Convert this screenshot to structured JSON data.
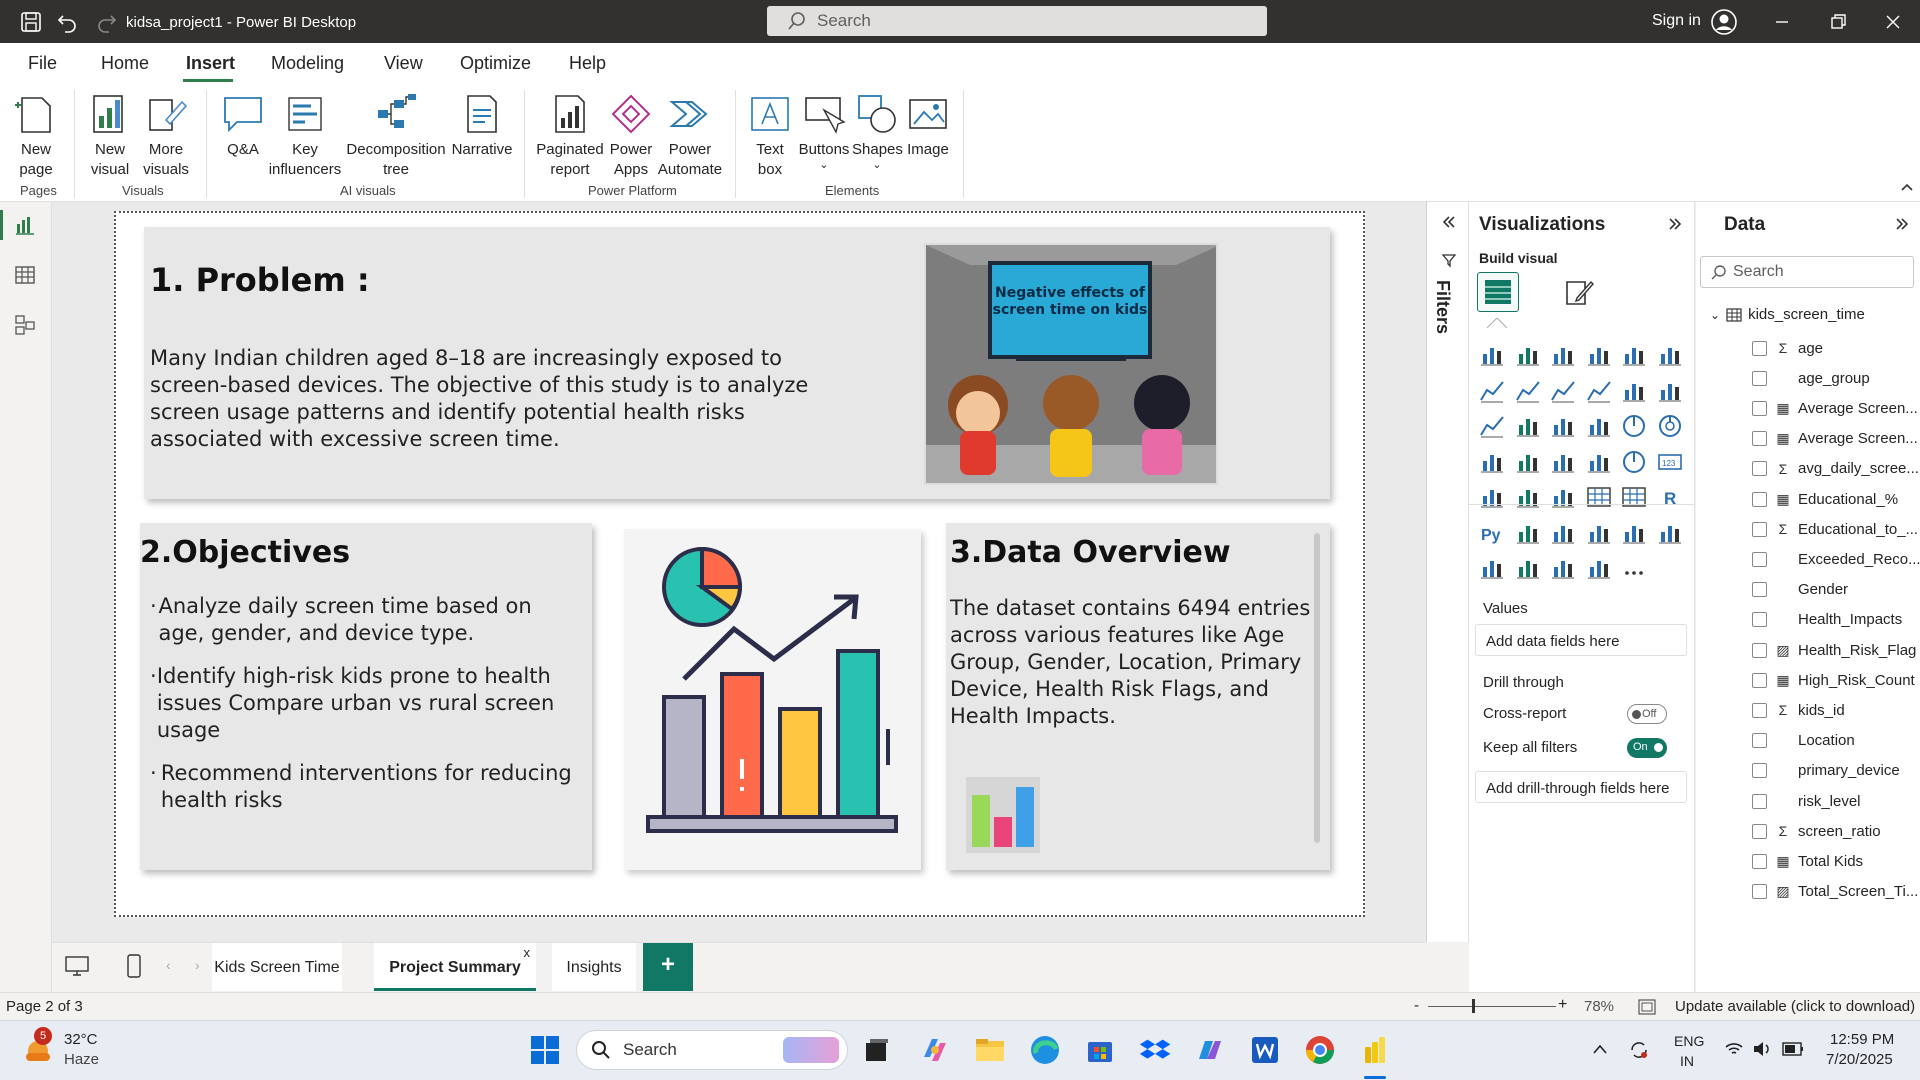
{
  "titlebar": {
    "app_title": "kidsa_project1 - Power BI Desktop",
    "search_placeholder": "Search",
    "sign_in": "Sign in"
  },
  "menu": {
    "items": [
      "File",
      "Home",
      "Insert",
      "Modeling",
      "View",
      "Optimize",
      "Help"
    ],
    "active": "Insert"
  },
  "ribbon": {
    "new_page": "New\npage",
    "new_visual": "New\nvisual",
    "more_visuals": "More\nvisuals",
    "qa": "Q&A",
    "key_influencers": "Key\ninfluencers",
    "decomposition_tree": "Decomposition\ntree",
    "narrative": "Narrative",
    "paginated_report": "Paginated\nreport",
    "power_apps": "Power\nApps",
    "power_automate": "Power\nAutomate",
    "text_box": "Text\nbox",
    "buttons": "Buttons",
    "shapes": "Shapes",
    "image": "Image",
    "groups": {
      "pages": "Pages",
      "visuals": "Visuals",
      "ai_visuals": "AI visuals",
      "power_platform": "Power Platform",
      "elements": "Elements"
    }
  },
  "report": {
    "problem_title": "1. Problem :",
    "problem_body": "Many Indian children aged 8–18 are increasingly exposed to screen-based devices. The objective of this study is to analyze screen usage patterns and identify potential health risks associated with excessive screen time.",
    "problem_image_caption": "Negative effects of screen time on kids",
    "objectives_title": "2.Objectives",
    "objectives": [
      "Analyze daily screen time based on age, gender, and device type.",
      "Identify high-risk kids prone to health issues Compare urban vs rural screen usage",
      "Recommend interventions for reducing health risks"
    ],
    "overview_title": "3.Data Overview",
    "overview_body": "The dataset contains 6494 entries across various features like Age Group, Gender, Location, Primary Device, Health Risk Flags, and Health Impacts."
  },
  "filters": {
    "label": "Filters"
  },
  "visualizations": {
    "title": "Visualizations",
    "build_visual": "Build visual",
    "values_label": "Values",
    "values_well": "Add data fields here",
    "drill_through": "Drill through",
    "cross_report": "Cross-report",
    "cross_report_state": "Off",
    "keep_filters": "Keep all filters",
    "keep_filters_state": "On",
    "drill_well": "Add drill-through fields here"
  },
  "data_pane": {
    "title": "Data",
    "search_placeholder": "Search",
    "table": "kids_screen_time",
    "fields": [
      {
        "name": "age",
        "type": "sigma"
      },
      {
        "name": "age_group",
        "type": "none"
      },
      {
        "name": "Average Screen...",
        "type": "calc"
      },
      {
        "name": "Average Screen...",
        "type": "calc"
      },
      {
        "name": "avg_daily_scree...",
        "type": "sigma"
      },
      {
        "name": "Educational_%",
        "type": "calc"
      },
      {
        "name": "Educational_to_...",
        "type": "sigma"
      },
      {
        "name": "Exceeded_Reco...",
        "type": "none"
      },
      {
        "name": "Gender",
        "type": "none"
      },
      {
        "name": "Health_Impacts",
        "type": "none"
      },
      {
        "name": "Health_Risk_Flag",
        "type": "calcmeasure"
      },
      {
        "name": "High_Risk_Count",
        "type": "calc"
      },
      {
        "name": "kids_id",
        "type": "sigma"
      },
      {
        "name": "Location",
        "type": "none"
      },
      {
        "name": "primary_device",
        "type": "none"
      },
      {
        "name": "risk_level",
        "type": "none"
      },
      {
        "name": "screen_ratio",
        "type": "sigma"
      },
      {
        "name": "Total Kids",
        "type": "calc"
      },
      {
        "name": "Total_Screen_Ti...",
        "type": "calcmeasure"
      }
    ]
  },
  "tabs": {
    "items": [
      "Kids Screen Time",
      "Project Summary",
      "Insights"
    ],
    "active": "Project Summary",
    "add": "+"
  },
  "status": {
    "page": "Page 2 of 3",
    "zoom": "78%",
    "update": "Update available (click to download)"
  },
  "taskbar": {
    "temp": "32°C",
    "weather": "Haze",
    "badge": "5",
    "search": "Search",
    "lang1": "ENG",
    "lang2": "IN",
    "time": "12:59 PM",
    "date": "7/20/2025"
  },
  "colors": {
    "accent_green": "#117865",
    "title_dark": "#323130",
    "tab_active_line": "#117865"
  }
}
